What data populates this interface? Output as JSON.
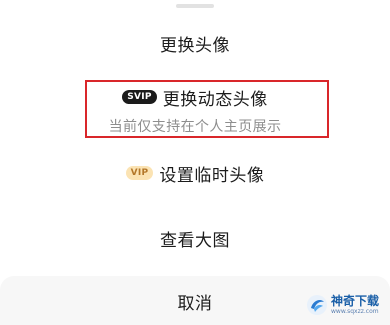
{
  "sheet": {
    "options": [
      {
        "label": "更换头像"
      },
      {
        "badge": "SVIP",
        "label": "更换动态头像",
        "sublabel": "当前仅支持在个人主页展示"
      },
      {
        "badge": "VIP",
        "label": "设置临时头像"
      },
      {
        "label": "查看大图"
      }
    ],
    "cancel_label": "取消"
  },
  "watermark": {
    "title": "神奇下载",
    "url": "www.sqxzz.com"
  },
  "colors": {
    "highlight_border": "#d9262a",
    "svip_badge_bg": "#1b1b1b",
    "vip_badge_bg": "#fbe3b3",
    "vip_badge_text": "#b3772a",
    "sublabel_text": "#8e8e8e"
  }
}
